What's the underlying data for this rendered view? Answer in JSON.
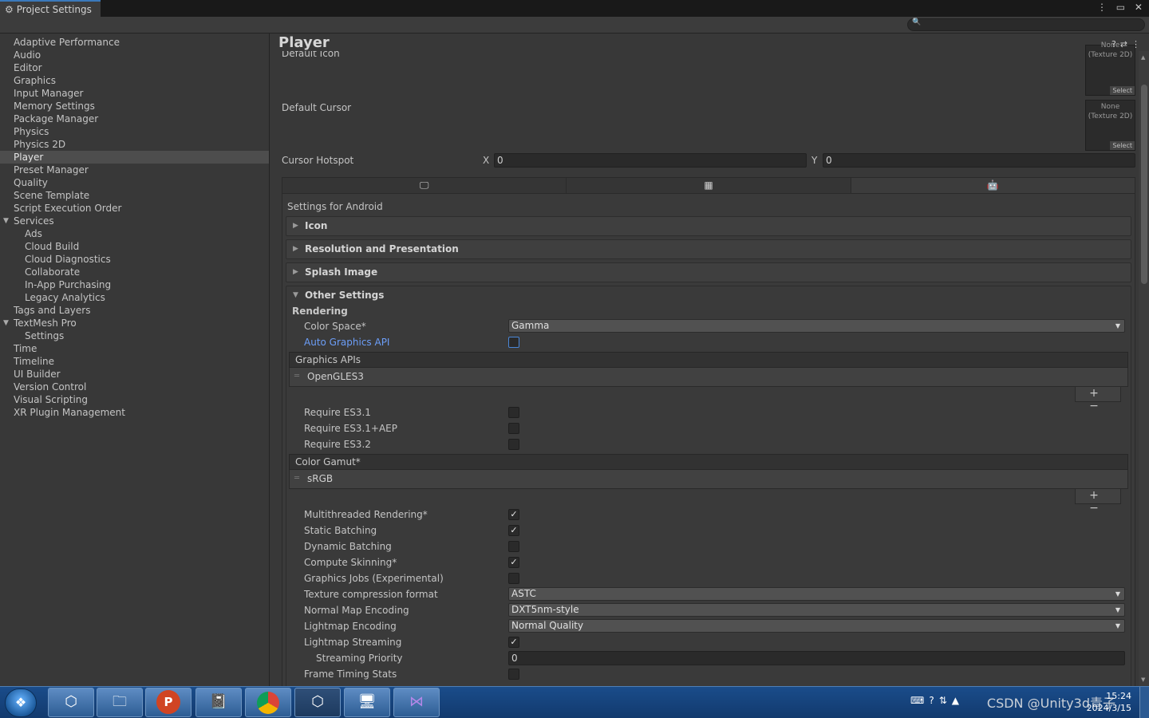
{
  "window": {
    "tab_title": "Project Settings",
    "title_buttons": "⋮ ▭ ✕"
  },
  "sidebar": {
    "items": [
      {
        "label": "Adaptive Performance",
        "level": 0
      },
      {
        "label": "Audio",
        "level": 0
      },
      {
        "label": "Editor",
        "level": 0
      },
      {
        "label": "Graphics",
        "level": 0
      },
      {
        "label": "Input Manager",
        "level": 0
      },
      {
        "label": "Memory Settings",
        "level": 0
      },
      {
        "label": "Package Manager",
        "level": 0
      },
      {
        "label": "Physics",
        "level": 0
      },
      {
        "label": "Physics 2D",
        "level": 0
      },
      {
        "label": "Player",
        "level": 0,
        "selected": true
      },
      {
        "label": "Preset Manager",
        "level": 0
      },
      {
        "label": "Quality",
        "level": 0
      },
      {
        "label": "Scene Template",
        "level": 0
      },
      {
        "label": "Script Execution Order",
        "level": 0
      },
      {
        "label": "Services",
        "level": 0,
        "foldout": true
      },
      {
        "label": "Ads",
        "level": 1
      },
      {
        "label": "Cloud Build",
        "level": 1
      },
      {
        "label": "Cloud Diagnostics",
        "level": 1
      },
      {
        "label": "Collaborate",
        "level": 1
      },
      {
        "label": "In-App Purchasing",
        "level": 1
      },
      {
        "label": "Legacy Analytics",
        "level": 1
      },
      {
        "label": "Tags and Layers",
        "level": 0
      },
      {
        "label": "TextMesh Pro",
        "level": 0,
        "foldout": true
      },
      {
        "label": "Settings",
        "level": 1
      },
      {
        "label": "Time",
        "level": 0
      },
      {
        "label": "Timeline",
        "level": 0
      },
      {
        "label": "UI Builder",
        "level": 0
      },
      {
        "label": "Version Control",
        "level": 0
      },
      {
        "label": "Visual Scripting",
        "level": 0
      },
      {
        "label": "XR Plugin Management",
        "level": 0
      }
    ]
  },
  "main": {
    "title": "Player",
    "cut_label": "Default Icon",
    "texture_none": "None\n(Texture 2D)",
    "texture_none_top": "None",
    "texture_type": "(Texture 2D)",
    "texture_select": "Select",
    "default_cursor_label": "Default Cursor",
    "cursor_hotspot_label": "Cursor Hotspot",
    "hotspot_x_label": "X",
    "hotspot_x_value": "0",
    "hotspot_y_label": "Y",
    "hotspot_y_value": "0",
    "platform_tabs": [
      "desktop-icon",
      "webgl-icon",
      "android-icon"
    ],
    "settings_for": "Settings for Android",
    "sections": {
      "icon": "Icon",
      "resolution": "Resolution and Presentation",
      "splash": "Splash Image",
      "other": "Other Settings"
    },
    "rendering": {
      "header": "Rendering",
      "color_space_label": "Color Space*",
      "color_space_value": "Gamma",
      "auto_graphics_api_label": "Auto Graphics API",
      "auto_graphics_api_checked": false,
      "graphics_apis_header": "Graphics APIs",
      "graphics_apis_item": "OpenGLES3",
      "require_es31": "Require ES3.1",
      "require_es31_aep": "Require ES3.1+AEP",
      "require_es32": "Require ES3.2",
      "color_gamut_header": "Color Gamut*",
      "color_gamut_item": "sRGB",
      "multithreaded_label": "Multithreaded Rendering*",
      "static_batching_label": "Static Batching",
      "dynamic_batching_label": "Dynamic Batching",
      "compute_skinning_label": "Compute Skinning*",
      "graphics_jobs_label": "Graphics Jobs (Experimental)",
      "texture_compression_label": "Texture compression format",
      "texture_compression_value": "ASTC",
      "normal_map_label": "Normal Map Encoding",
      "normal_map_value": "DXT5nm-style",
      "lightmap_encoding_label": "Lightmap Encoding",
      "lightmap_encoding_value": "Normal Quality",
      "lightmap_streaming_label": "Lightmap Streaming",
      "streaming_priority_label": "Streaming Priority",
      "streaming_priority_value": "0",
      "frame_timing_label": "Frame Timing Stats"
    },
    "list_buttons": "+ −"
  },
  "taskbar": {
    "apps": [
      "unity-hub-icon",
      "file-explorer-icon",
      "powerpoint-icon",
      "notepad-icon",
      "chrome-icon",
      "unity-icon",
      "remote-desktop-icon",
      "visual-studio-icon"
    ],
    "tray_watermark": "CSDN @Unity3d青子",
    "time": "15:24",
    "date": "2024/3/15"
  },
  "colors": {
    "accent_blue": "#3a79bb",
    "link_blue": "#6c9ef8",
    "panel_bg": "#383838",
    "selected_bg": "#4d4d4d"
  }
}
